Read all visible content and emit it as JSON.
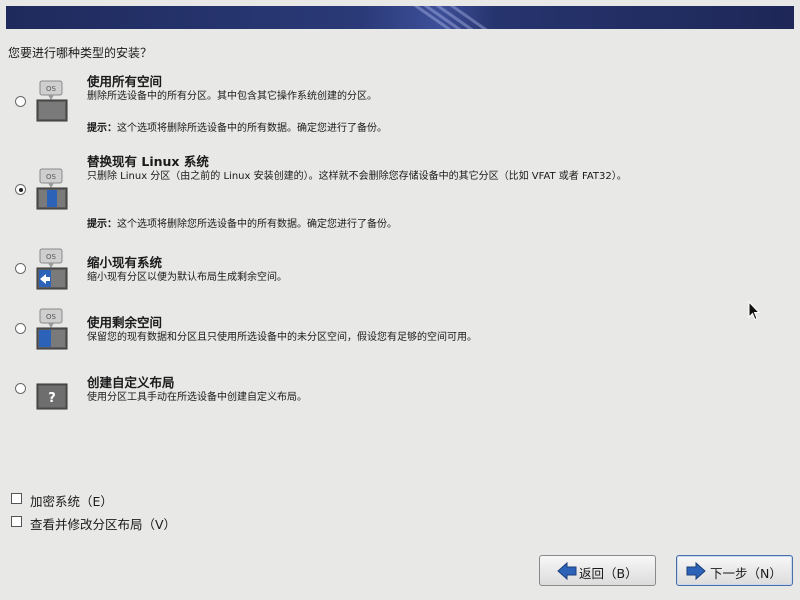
{
  "question": "您要进行哪种类型的安装？",
  "options": [
    {
      "title": "使用所有空间",
      "description": "删除所选设备中的所有分区。其中包含其它操作系统创建的分区。",
      "tip_label": "提示：",
      "tip_text": "这个选项将删除所选设备中的所有数据。确定您进行了备份。",
      "selected": false,
      "icon": "os-replace-drive-icon"
    },
    {
      "title": "替换现有 Linux 系统",
      "description": "只删除 Linux 分区（由之前的 Linux 安装创建的）。这样就不会删除您存储设备中的其它分区（比如 VFAT 或者 FAT32）。",
      "tip_label": "提示：",
      "tip_text": "这个选项将删除您所选设备中的所有数据。确定您进行了备份。",
      "selected": true,
      "icon": "os-replace-linux-icon"
    },
    {
      "title": "缩小现有系统",
      "description": "缩小现有分区以便为默认布局生成剩余空间。",
      "selected": false,
      "icon": "os-shrink-icon"
    },
    {
      "title": "使用剩余空间",
      "description": "保留您的现有数据和分区且只使用所选设备中的未分区空间，假设您有足够的空间可用。",
      "selected": false,
      "icon": "os-free-space-icon"
    },
    {
      "title": "创建自定义布局",
      "description": "使用分区工具手动在所选设备中创建自定义布局。",
      "selected": false,
      "icon": "custom-layout-question-icon"
    }
  ],
  "checkboxes": {
    "encrypt": "加密系统（E）",
    "review": "查看并修改分区布局（V）"
  },
  "buttons": {
    "back": "返回（B）",
    "next": "下一步（N）"
  },
  "colors": {
    "banner": "#1f2a5c",
    "background": "#e8e8e7",
    "accent_blue": "#2c62b8"
  }
}
